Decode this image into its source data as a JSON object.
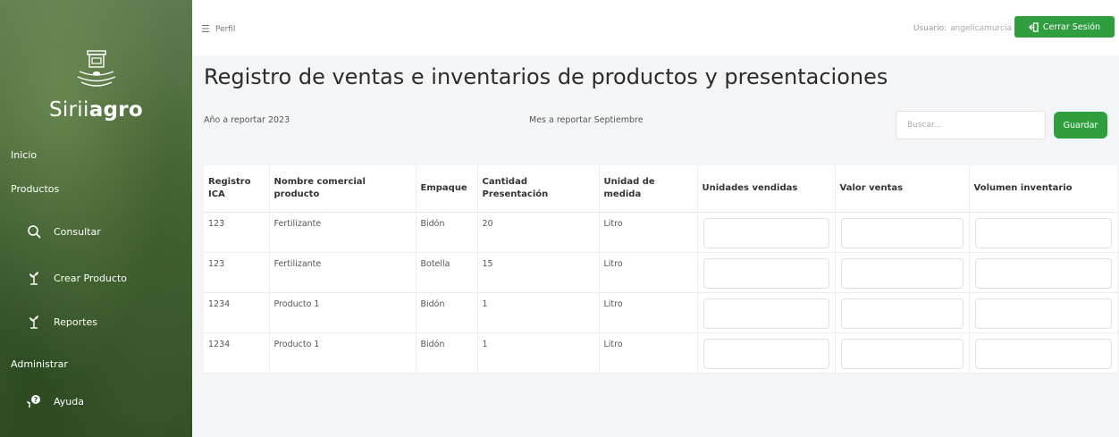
{
  "brand": {
    "name_light": "Sirii",
    "name_bold": "agro"
  },
  "sidebar": {
    "sections": {
      "home": "Inicio",
      "products": "Productos",
      "admin": "Administrar"
    },
    "items": [
      {
        "label": "Consultar",
        "icon": "search-icon"
      },
      {
        "label": "Crear Producto",
        "icon": "plant-icon"
      },
      {
        "label": "Reportes",
        "icon": "plant-icon"
      },
      {
        "label": "Ayuda",
        "icon": "help-icon"
      }
    ]
  },
  "topbar": {
    "menu_label": "Perfil",
    "user_prefix": "Usuario:",
    "username": "angelicamurcia",
    "logout_label": "Cerrar Sesión"
  },
  "main": {
    "title": "Registro de ventas e inventarios de productos y presentaciones",
    "year_text": "Año a reportar 2023",
    "month_text": "Mes a reportar Septiembre",
    "search_placeholder": "Buscar...",
    "save_label": "Guardar"
  },
  "table": {
    "headers": [
      "Registro ICA",
      "Nombre comercial producto",
      "Empaque",
      "Cantidad Presentación",
      "Unidad de medida",
      "Unidades vendidas",
      "Valor ventas",
      "Volumen inventario"
    ],
    "rows": [
      {
        "ica": "123",
        "name": "Fertilizante",
        "package": "Bidón",
        "qty": "20",
        "unit": "Litro"
      },
      {
        "ica": "123",
        "name": "Fertilizante",
        "package": "Botella",
        "qty": "15",
        "unit": "Litro"
      },
      {
        "ica": "1234",
        "name": "Producto 1",
        "package": "Bidón",
        "qty": "1",
        "unit": "Litro"
      },
      {
        "ica": "1234",
        "name": "Producto 1",
        "package": "Bidón",
        "qty": "1",
        "unit": "Litro"
      }
    ]
  },
  "colors": {
    "accent": "#2e9e3e",
    "sidebar": "#4e6d3c"
  }
}
